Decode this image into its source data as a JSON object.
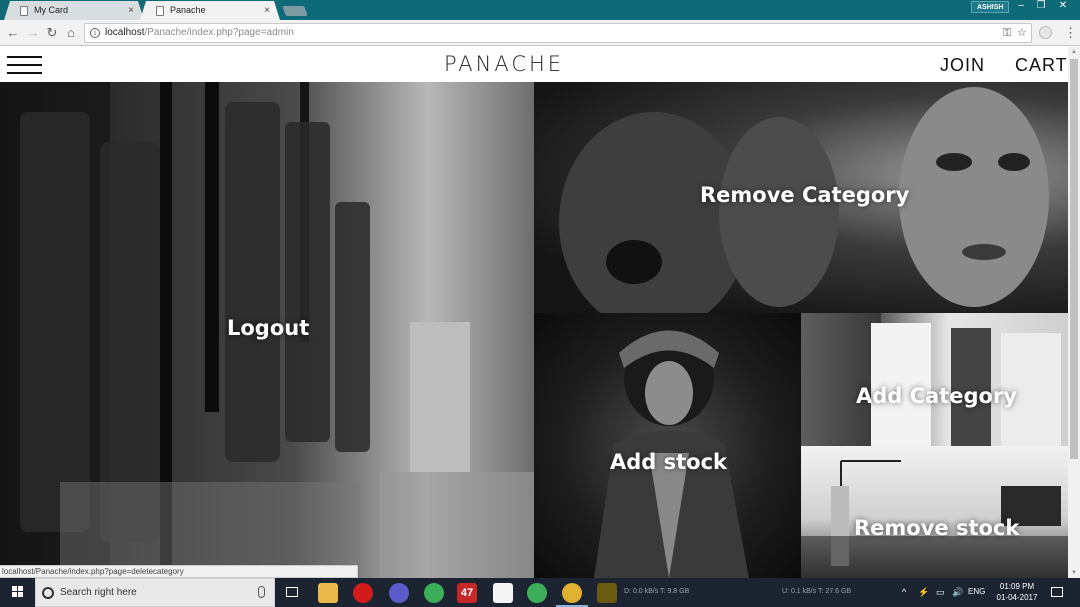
{
  "browser": {
    "tabs": [
      {
        "title": "My Card",
        "active": false
      },
      {
        "title": "Panache",
        "active": true
      }
    ],
    "profile": "ASHISH",
    "window_controls": {
      "minimize": "–",
      "restore": "❐",
      "close": "✕"
    },
    "nav_icons": {
      "back": "←",
      "forward": "→",
      "reload": "↻",
      "home": "⌂"
    },
    "tab_close": "×",
    "url_host": "localhost",
    "url_path": "/Panache/index.php?page=admin",
    "status_url": "localhost/Panache/index.php?page=deletecategory"
  },
  "site": {
    "logo": "PANACHE",
    "nav": {
      "join": "JOIN",
      "cart": "CART"
    }
  },
  "tiles": {
    "logout": "Logout",
    "remove_category": "Remove Category",
    "add_stock": "Add stock",
    "add_category": "Add Category",
    "remove_stock": "Remove stock"
  },
  "taskbar": {
    "search_placeholder": "Search right here",
    "badge_count": "47",
    "net_down": "D: 0.0 kB/s T: 9.8 GB",
    "net_up": "U: 0.1 kB/s T: 27.6 GB",
    "language": "ENG",
    "time": "01:09 PM",
    "date": "01-04-2017"
  },
  "colors": {
    "tab_strip": "#0f6a78",
    "taskbar": "#1b2430",
    "tile_text": "#ffffff"
  }
}
